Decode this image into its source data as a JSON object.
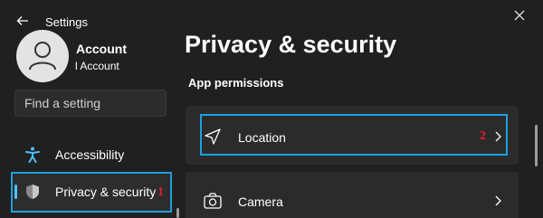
{
  "window": {
    "title": "Settings"
  },
  "account": {
    "name": "Account",
    "subtitle": "l Account"
  },
  "search": {
    "placeholder": "Find a setting"
  },
  "sidebar": {
    "items": [
      {
        "label": "Accessibility",
        "icon": "accessibility-icon"
      },
      {
        "label": "Privacy & security",
        "icon": "shield-icon",
        "selected": true
      }
    ]
  },
  "main": {
    "title": "Privacy & security",
    "section_title": "App permissions",
    "items": [
      {
        "label": "Location",
        "icon": "location-icon"
      },
      {
        "label": "Camera",
        "icon": "camera-icon"
      }
    ]
  },
  "annotations": {
    "step1": "1",
    "step2": "2"
  },
  "colors": {
    "background": "#202020",
    "card": "#2b2b2b",
    "accent": "#4cc2ff",
    "highlight": "#1ba1e2",
    "step_number": "#e0202a"
  }
}
